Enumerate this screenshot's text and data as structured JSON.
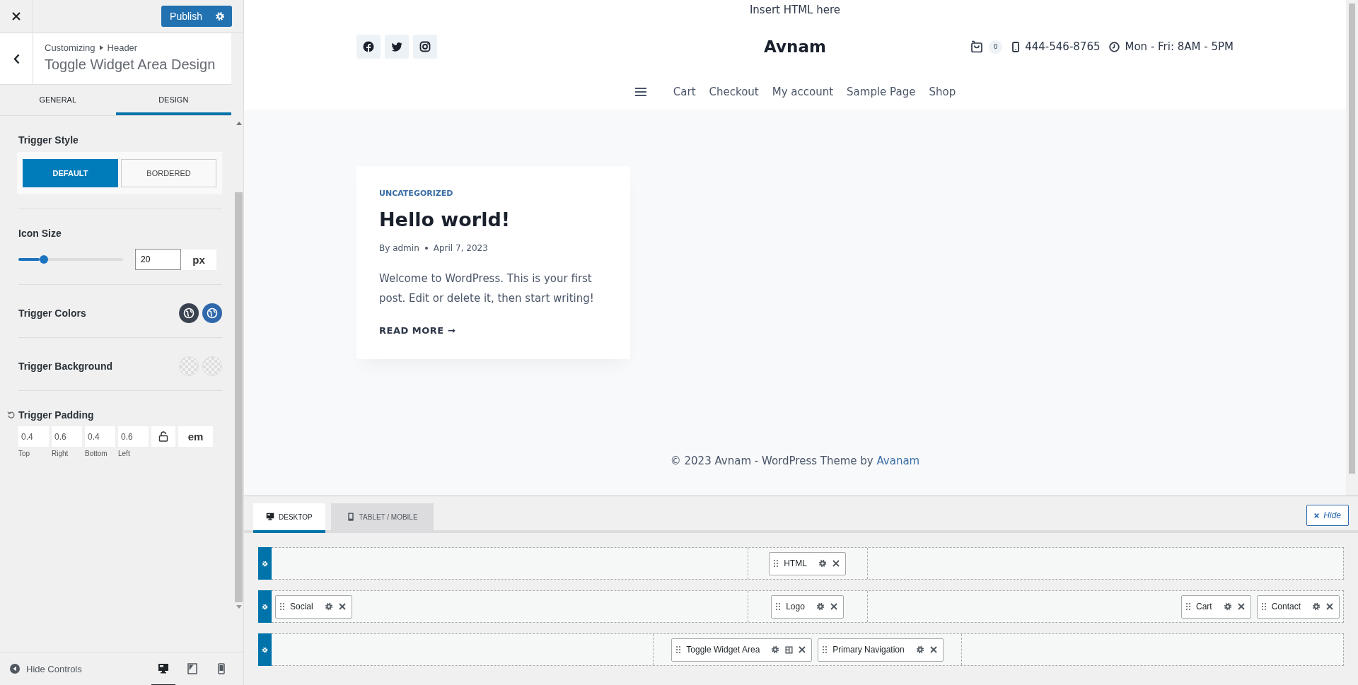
{
  "topbar": {
    "publish": "Publish"
  },
  "panel_header": {
    "breadcrumb": [
      "Customizing",
      "Header"
    ],
    "title": "Toggle Widget Area Design"
  },
  "tabs": [
    {
      "label": "GENERAL",
      "selected": false
    },
    {
      "label": "DESIGN",
      "selected": true
    }
  ],
  "trigger_style": {
    "label": "Trigger Style",
    "options": [
      {
        "label": "DEFAULT",
        "selected": true
      },
      {
        "label": "BORDERED",
        "selected": false
      }
    ]
  },
  "icon_size": {
    "label": "Icon Size",
    "level": 0.2,
    "value": "20",
    "unit": "px"
  },
  "trigger_colors": {
    "label": "Trigger Colors",
    "swatches": [
      {
        "color": "#3a4250"
      },
      {
        "color": "#2f68ab"
      }
    ]
  },
  "trigger_background": {
    "label": "Trigger Background",
    "swatches": [
      {
        "kind": "transparent"
      },
      {
        "kind": "transparent"
      }
    ]
  },
  "trigger_padding": {
    "label": "Trigger Padding",
    "linked": false,
    "unit": "em",
    "fields": [
      {
        "value": "0.4",
        "label": "Top"
      },
      {
        "value": "0.6",
        "label": "Right"
      },
      {
        "value": "0.4",
        "label": "Bottom"
      },
      {
        "value": "0.6",
        "label": "Left"
      }
    ]
  },
  "panel_footer": {
    "hide_controls": "Hide Controls",
    "devices": [
      {
        "kind": "desktop",
        "selected": true
      },
      {
        "kind": "tablet",
        "selected": false
      },
      {
        "kind": "mobile",
        "selected": false
      }
    ]
  },
  "preview": {
    "top_html": "Insert HTML here",
    "social": [
      {
        "kind": "facebook"
      },
      {
        "kind": "twitter"
      },
      {
        "kind": "instagram"
      }
    ],
    "logo": "Avnam",
    "cart_count": "0",
    "phone": "444-546-8765",
    "hours": "Mon - Fri: 8AM - 5PM",
    "nav": [
      "Cart",
      "Checkout",
      "My account",
      "Sample Page",
      "Shop"
    ],
    "post": {
      "category": "UNCATEGORIZED",
      "title": "Hello world!",
      "author": "By admin",
      "date": "April 7, 2023",
      "excerpt": "Welcome to WordPress. This is your first post. Edit or delete it, then start writing!",
      "read_more": "READ MORE →"
    },
    "footer_text": "© 2023 Avnam - WordPress Theme by ",
    "footer_link": "Avanam"
  },
  "builder": {
    "tabs": [
      {
        "label": "DESKTOP",
        "kind": "desktop",
        "selected": true
      },
      {
        "label": "TABLET / MOBILE",
        "kind": "mobile",
        "selected": false
      }
    ],
    "hide": "Hide",
    "rows": [
      {
        "left": [],
        "center": [
          {
            "label": "HTML",
            "layout_button": false
          }
        ],
        "right": []
      },
      {
        "left": [
          {
            "label": "Social",
            "layout_button": false
          }
        ],
        "center": [
          {
            "label": "Logo",
            "layout_button": false
          }
        ],
        "right": [
          {
            "label": "Cart",
            "layout_button": false
          },
          {
            "label": "Contact",
            "layout_button": false
          }
        ]
      },
      {
        "left": [],
        "center": [
          {
            "label": "Toggle Widget Area",
            "layout_button": true
          },
          {
            "label": "Primary Navigation",
            "layout_button": false
          }
        ],
        "right": []
      }
    ]
  }
}
